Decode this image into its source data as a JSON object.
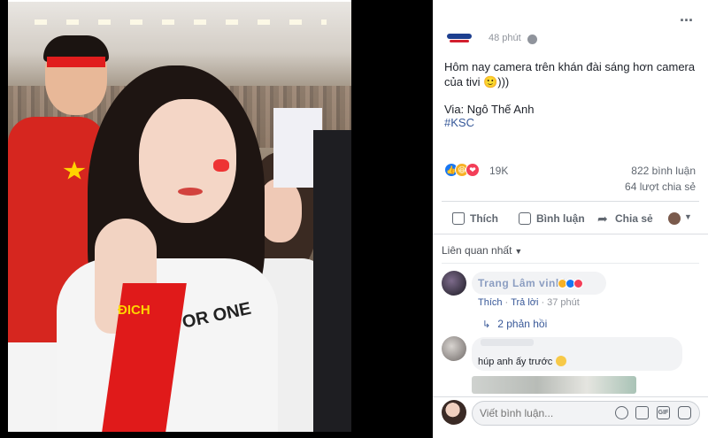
{
  "photo": {
    "scarf_text": "ĐICH",
    "shirt_text": "OR ONE"
  },
  "post": {
    "timestamp": "48 phút",
    "text_line1": "Hôm nay camera trên khán đài sáng hơn camera",
    "text_line2": "của tivi 🙂)))",
    "via": "Via: Ngô Thế Anh",
    "hashtag": "#KSC",
    "reaction_count": "19K",
    "comment_count": "822 bình luận",
    "share_count": "64 lượt chia sẻ"
  },
  "actions": {
    "like": "Thích",
    "comment": "Bình luận",
    "share": "Chia sẻ"
  },
  "comments": {
    "sort_label": "Liên quan nhất",
    "c1": {
      "name": "Trang Lâm vinhh",
      "reaction_count": "",
      "like": "Thích",
      "reply": "Trả lời",
      "time": "37 phút",
      "replies": "2 phản hồi"
    },
    "c2": {
      "text": "húp anh ấy trước"
    }
  },
  "composer": {
    "placeholder": "Viết bình luận...",
    "gif_label": "GIF"
  },
  "colors": {
    "link": "#385898",
    "like_blue": "#1877f2",
    "love_red": "#f33e58",
    "haha_yellow": "#f7b125"
  }
}
